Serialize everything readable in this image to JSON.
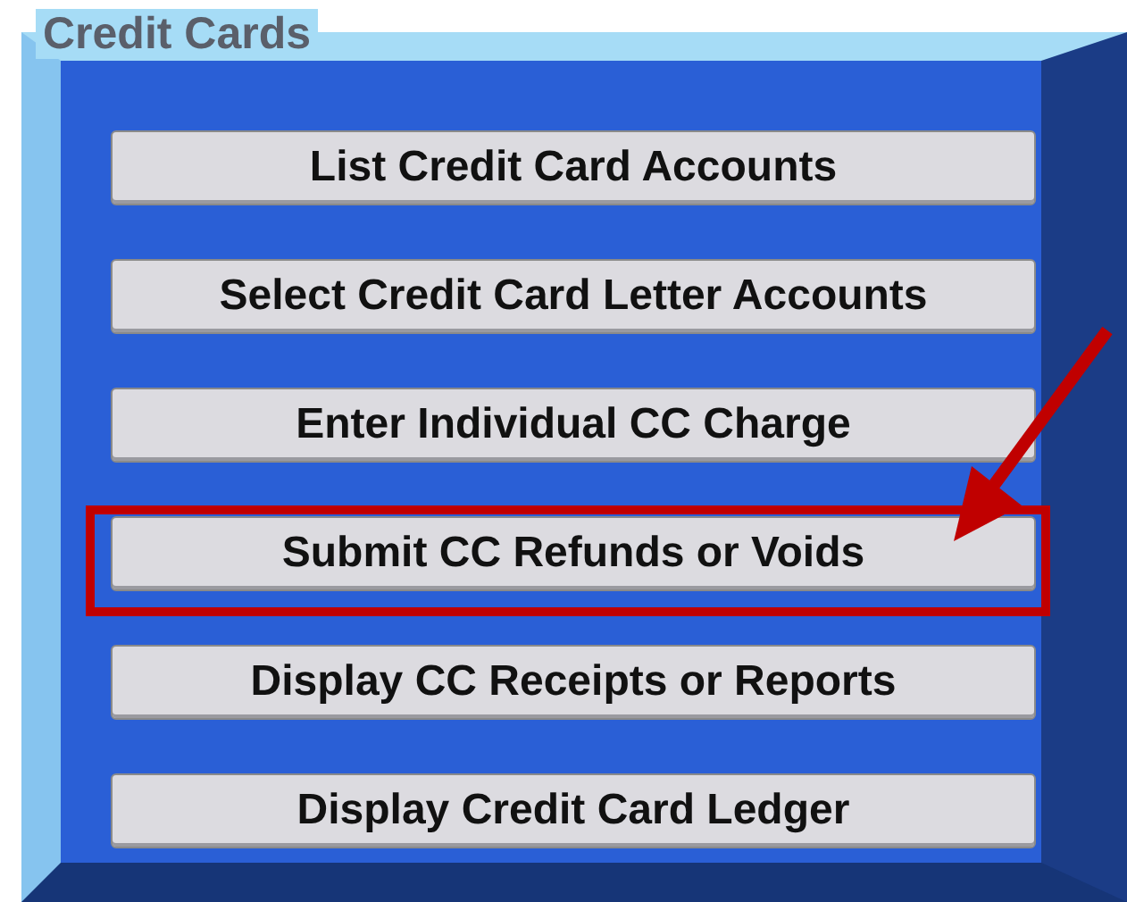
{
  "panel": {
    "title": "Credit Cards"
  },
  "buttons": [
    {
      "label": "List Credit Card Accounts",
      "highlighted": false
    },
    {
      "label": "Select Credit Card Letter Accounts",
      "highlighted": false
    },
    {
      "label": "Enter Individual CC Charge",
      "highlighted": false
    },
    {
      "label": "Submit CC Refunds or Voids",
      "highlighted": true
    },
    {
      "label": "Display CC Receipts or Reports",
      "highlighted": false
    },
    {
      "label": "Display Credit Card Ledger",
      "highlighted": false
    }
  ]
}
